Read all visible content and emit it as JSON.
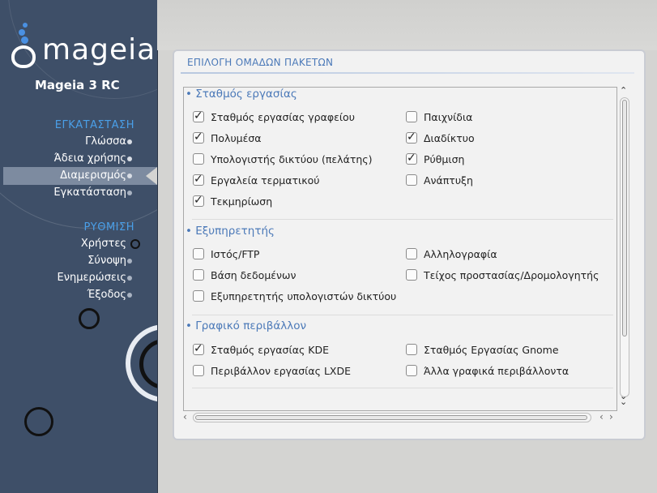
{
  "sidebar": {
    "logo_text": "mageia",
    "version": "Mageia 3 RC",
    "sections": [
      {
        "header": "ΕΓΚΑΤΑΣΤΑΣΗ",
        "steps": [
          {
            "label": "Γλώσσα",
            "state": "done"
          },
          {
            "label": "Άδεια χρήσης",
            "state": "done"
          },
          {
            "label": "Διαμερισμός",
            "state": "current"
          },
          {
            "label": "Εγκατάσταση",
            "state": "todo"
          }
        ]
      },
      {
        "header": "ΡΥΘΜΙΣΗ",
        "steps": [
          {
            "label": "Χρήστες",
            "state": "todo"
          },
          {
            "label": "Σύνοψη",
            "state": "todo"
          },
          {
            "label": "Ενημερώσεις",
            "state": "todo"
          },
          {
            "label": "Έξοδος",
            "state": "todo"
          }
        ]
      }
    ]
  },
  "panel": {
    "title": "ΕΠΙΛΟΓΗ ΟΜΑΔΩΝ ΠΑΚΕΤΩΝ"
  },
  "groups": [
    {
      "title": "• Σταθμός εργασίας",
      "items": [
        {
          "label": "Σταθμός εργασίας γραφείου",
          "checked": true
        },
        {
          "label": "Παιχνίδια",
          "checked": false
        },
        {
          "label": "Πολυμέσα",
          "checked": true
        },
        {
          "label": "Διαδίκτυο",
          "checked": true
        },
        {
          "label": "Υπολογιστής δικτύου (πελάτης)",
          "checked": false
        },
        {
          "label": "Ρύθμιση",
          "checked": true
        },
        {
          "label": "Εργαλεία τερματικού",
          "checked": true
        },
        {
          "label": "Ανάπτυξη",
          "checked": false
        },
        {
          "label": "Τεκμηρίωση",
          "checked": true
        }
      ]
    },
    {
      "title": "• Εξυπηρετητής",
      "items": [
        {
          "label": "Ιστός/FTP",
          "checked": false
        },
        {
          "label": "Αλληλογραφία",
          "checked": false
        },
        {
          "label": "Βάση δεδομένων",
          "checked": false
        },
        {
          "label": "Τείχος προστασίας/Δρομολογητής",
          "checked": false
        },
        {
          "label": "Εξυπηρετητής υπολογιστών δικτύου",
          "checked": false
        }
      ]
    },
    {
      "title": "• Γραφικό περιβάλλον",
      "items": [
        {
          "label": "Σταθμός εργασίας KDE",
          "checked": true
        },
        {
          "label": "Σταθμός Εργασίας Gnome",
          "checked": false
        },
        {
          "label": "Περιβάλλον εργασίας LXDE",
          "checked": false
        },
        {
          "label": "Άλλα γραφικά περιβάλλοντα",
          "checked": false
        }
      ]
    }
  ],
  "icons": {
    "check": "✓",
    "scroll_up": "⌃",
    "scroll_down": "⌄",
    "scroll_left": "‹",
    "scroll_right": "›"
  }
}
